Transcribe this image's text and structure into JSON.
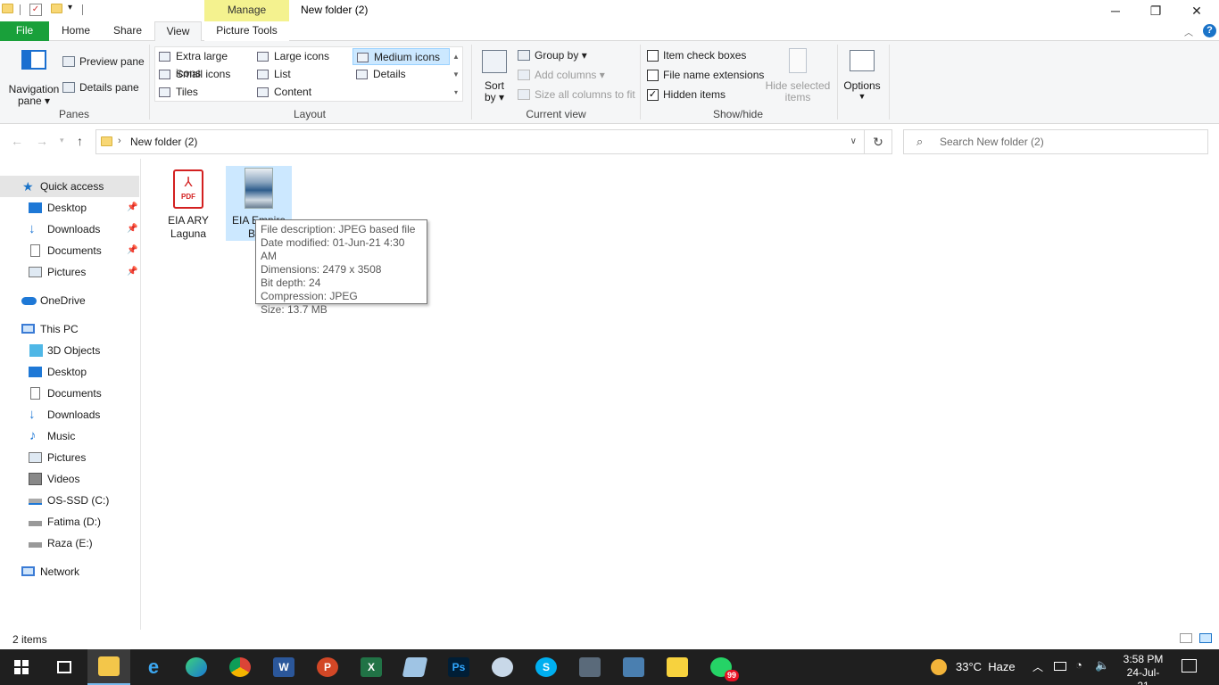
{
  "window": {
    "title": "New folder (2)",
    "contextual_tab": "Manage",
    "controls": {
      "minimize": "─",
      "restore": "❐",
      "close": "✕"
    }
  },
  "ribbon_tabs": [
    "File",
    "Home",
    "Share",
    "View",
    "Picture Tools"
  ],
  "ribbon": {
    "panes": {
      "navigation_pane": [
        "Navigation",
        "pane ▾"
      ],
      "preview_pane": "Preview pane",
      "details_pane": "Details pane",
      "group_label": "Panes"
    },
    "layout": {
      "options": [
        [
          "Extra large icons",
          "Large icons",
          "Medium icons"
        ],
        [
          "Small icons",
          "List",
          "Details"
        ],
        [
          "Tiles",
          "Content",
          ""
        ]
      ],
      "selected": "Medium icons",
      "group_label": "Layout"
    },
    "current_view": {
      "sort_by": [
        "Sort",
        "by ▾"
      ],
      "group_by": "Group by ▾",
      "add_columns": "Add columns ▾",
      "size_columns": "Size all columns to fit",
      "group_label": "Current view"
    },
    "show_hide": {
      "item_check_boxes": {
        "label": "Item check boxes",
        "checked": false
      },
      "file_name_extensions": {
        "label": "File name extensions",
        "checked": false
      },
      "hidden_items": {
        "label": "Hidden items",
        "checked": true
      },
      "hide_selected": [
        "Hide selected",
        "items"
      ],
      "group_label": "Show/hide"
    },
    "options": {
      "label": "Options"
    }
  },
  "address": {
    "path": "New folder (2)",
    "search_placeholder": "Search New folder (2)"
  },
  "nav": {
    "quick_access": "Quick access",
    "quick_items": [
      "Desktop",
      "Downloads",
      "Documents",
      "Pictures"
    ],
    "onedrive": "OneDrive",
    "this_pc": "This PC",
    "pc_items": [
      "3D Objects",
      "Desktop",
      "Documents",
      "Downloads",
      "Music",
      "Pictures",
      "Videos",
      "OS-SSD (C:)",
      "Fatima (D:)",
      "Raza (E:)"
    ],
    "network": "Network"
  },
  "files": [
    {
      "name_line1": "EIA ARY",
      "name_line2": "Laguna",
      "badge": "PDF"
    },
    {
      "name_line1": "EIA Empire",
      "name_line2": "Boul"
    }
  ],
  "tooltip": {
    "lines": [
      "File description: JPEG based file",
      "Date modified: 01-Jun-21 4:30 AM",
      "Dimensions: 2479 x 3508",
      "Bit depth: 24",
      "Compression: JPEG",
      "Size: 13.7 MB"
    ]
  },
  "status": {
    "item_count": "2 items"
  },
  "taskbar": {
    "weather": "33°C  Haze",
    "time": "3:58 PM",
    "date": "24-Jul-21",
    "whatsapp_badge": "99"
  }
}
